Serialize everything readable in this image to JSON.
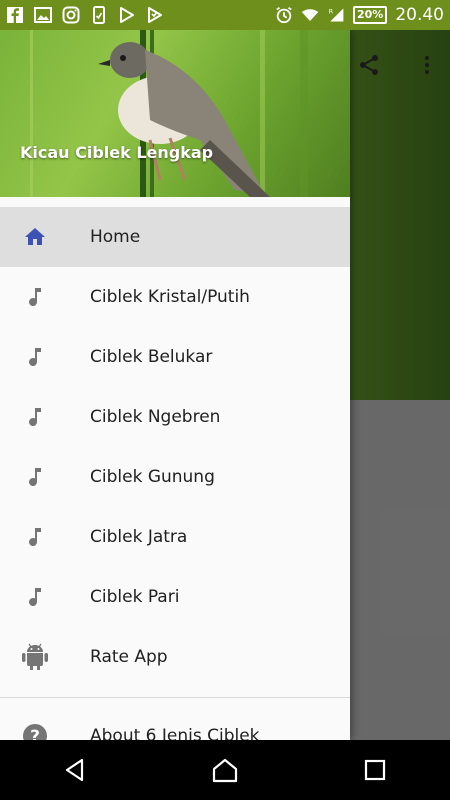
{
  "status_bar": {
    "time": "20.40",
    "battery": "20%",
    "background_color": "#6f8f1d",
    "left_icons": [
      "facebook-icon",
      "image-icon",
      "instagram-icon",
      "phone-icon",
      "play-store-icon",
      "download-icon"
    ],
    "right_icons": [
      "alarm-icon",
      "wifi-icon",
      "roaming-signal-icon",
      "battery-icon"
    ]
  },
  "app_bar": {
    "actions": [
      "share-icon",
      "more-vert-icon"
    ]
  },
  "drawer": {
    "header_title": "Kicau Ciblek Lengkap",
    "items": [
      {
        "label": "Home",
        "icon": "home-icon",
        "selected": true,
        "icon_color": "#3f51b5"
      },
      {
        "label": "Ciblek Kristal/Putih",
        "icon": "music-note-icon"
      },
      {
        "label": "Ciblek Belukar",
        "icon": "music-note-icon"
      },
      {
        "label": "Ciblek Ngebren",
        "icon": "music-note-icon"
      },
      {
        "label": "Ciblek Gunung",
        "icon": "music-note-icon"
      },
      {
        "label": "Ciblek Jatra",
        "icon": "music-note-icon"
      },
      {
        "label": "Ciblek Pari",
        "icon": "music-note-icon"
      },
      {
        "label": "Rate App",
        "icon": "android-icon"
      }
    ],
    "footer_items": [
      {
        "label": "About 6 Jenis Ciblek",
        "icon": "help-icon"
      }
    ]
  },
  "nav_bar": {
    "buttons": [
      "back-icon",
      "home-nav-icon",
      "recents-icon"
    ]
  }
}
